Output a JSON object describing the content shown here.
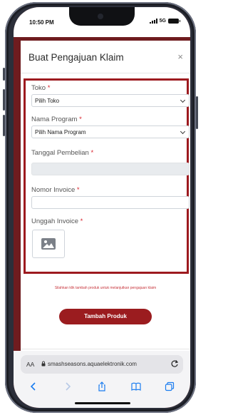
{
  "status_bar": {
    "time": "10:50 PM",
    "network": "5G"
  },
  "modal": {
    "title": "Buat Pengajuan Klaim",
    "close_label": "×",
    "fields": {
      "toko": {
        "label": "Toko",
        "required_mark": "*",
        "selected": "Pilih Toko"
      },
      "nama_program": {
        "label": "Nama Program",
        "required_mark": "*",
        "selected": "Pilih Nama Program"
      },
      "tanggal_pembelian": {
        "label": "Tanggal Pembelian",
        "required_mark": "*",
        "value": ""
      },
      "nomor_invoice": {
        "label": "Nomor Invoice",
        "required_mark": "*",
        "value": ""
      },
      "unggah_invoice": {
        "label": "Unggah Invoice",
        "required_mark": "*"
      }
    },
    "hint": "Silahkan klik tambah produk untuk melanjutkan pengajuan klaim",
    "primary_button": "Tambah Produk"
  },
  "browser": {
    "aa_label": "AA",
    "url": "smashseasons.aquaelektronik.com"
  },
  "colors": {
    "brand": "#9b1c1f",
    "required": "#d9232d",
    "ios_blue": "#1a7cf0"
  }
}
